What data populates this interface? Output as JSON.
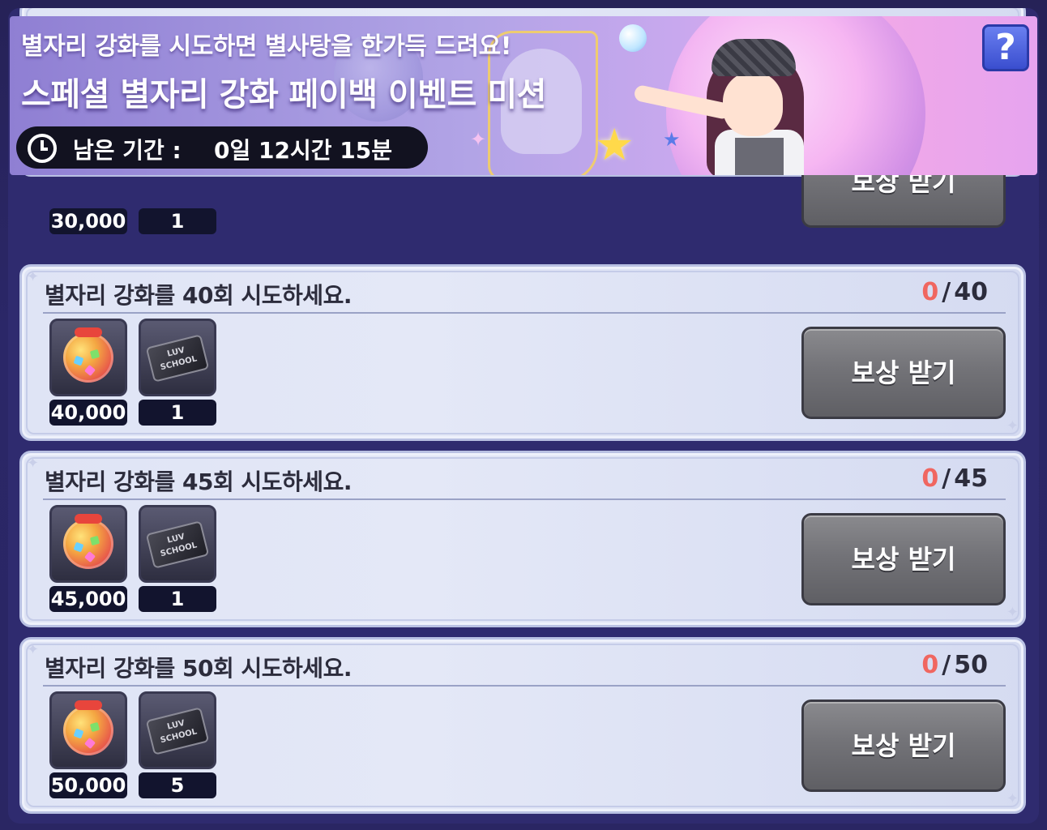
{
  "banner": {
    "subtitle": "별자리 강화를 시도하면 별사탕을 한가득 드려요!",
    "headline": "스페셜 별자리 강화 페이백 이벤트 미션",
    "timer_label": "남은 기간 :",
    "timer_value": "0일 12시간 15분",
    "help_label": "?"
  },
  "missions": [
    {
      "title": "",
      "progress_current": "",
      "progress_total": "",
      "rewards": [
        {
          "icon": "candy-jar-icon",
          "count": "30,000"
        },
        {
          "icon": "ticket-icon",
          "count": "1"
        }
      ],
      "button_label": "보상 받기"
    },
    {
      "title": "별자리 강화를 40회 시도하세요.",
      "progress_current": "0",
      "progress_sep": "/",
      "progress_total": "40",
      "rewards": [
        {
          "icon": "candy-jar-icon",
          "count": "40,000"
        },
        {
          "icon": "ticket-icon",
          "count": "1"
        }
      ],
      "button_label": "보상 받기"
    },
    {
      "title": "별자리 강화를 45회 시도하세요.",
      "progress_current": "0",
      "progress_sep": "/",
      "progress_total": "45",
      "rewards": [
        {
          "icon": "candy-jar-icon",
          "count": "45,000"
        },
        {
          "icon": "ticket-icon",
          "count": "1"
        }
      ],
      "button_label": "보상 받기"
    },
    {
      "title": "별자리 강화를 50회 시도하세요.",
      "progress_current": "0",
      "progress_sep": "/",
      "progress_total": "50",
      "rewards": [
        {
          "icon": "candy-jar-icon",
          "count": "50,000"
        },
        {
          "icon": "ticket-icon",
          "count": "5"
        }
      ],
      "button_label": "보상 받기"
    }
  ],
  "ticket_text": "LUV\nSCHOOL",
  "colors": {
    "progress_current": "#f06660",
    "panel_bg": "#2f2b6f",
    "card_bg": "#dfe4f5",
    "button_bg": "#737378"
  }
}
